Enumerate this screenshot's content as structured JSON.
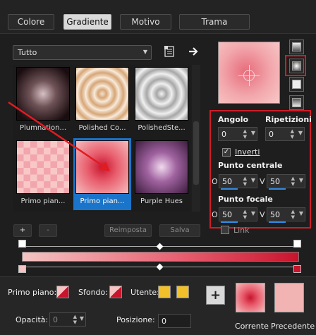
{
  "tabs": [
    {
      "label": "Colore",
      "active": false
    },
    {
      "label": "Gradiente",
      "active": true
    },
    {
      "label": "Motivo",
      "active": false
    },
    {
      "label": "Trama",
      "active": false
    }
  ],
  "library": {
    "filter_value": "Tutto",
    "thumbnails": [
      {
        "caption": "Plumnation...",
        "selected": false
      },
      {
        "caption": "Polished Co...",
        "selected": false
      },
      {
        "caption": "PolishedSte...",
        "selected": false
      },
      {
        "caption": "Primo pian...",
        "selected": false
      },
      {
        "caption": "Primo pian...",
        "selected": true
      },
      {
        "caption": "Purple Hues",
        "selected": false
      }
    ],
    "buttons": {
      "add": "+",
      "remove": "-",
      "reset": "Reimposta",
      "save": "Salva"
    }
  },
  "settings": {
    "angle_label": "Angolo",
    "angle_value": "0",
    "repeats_label": "Ripetizioni",
    "repeats_value": "0",
    "invert_label": "Inverti",
    "invert_checked": true,
    "center_label": "Punto centrale",
    "center_o_label": "O",
    "center_o_value": "50",
    "center_v_label": "V",
    "center_v_value": "50",
    "focal_label": "Punto focale",
    "focal_o_label": "O",
    "focal_o_value": "50",
    "focal_v_label": "V",
    "focal_v_value": "50",
    "link_label": "Link",
    "link_checked": false
  },
  "bottom": {
    "foreground_label": "Primo piano:",
    "background_label": "Sfondo:",
    "user_label": "Utente:",
    "opacity_label": "Opacità:",
    "opacity_value": "0",
    "position_label": "Posizione:",
    "position_value": "0",
    "current_label": "Corrente",
    "previous_label": "Precedente",
    "add_label": "+"
  },
  "colors": {
    "gradient_start": "#f5c4c3",
    "gradient_end": "#c8142d",
    "user_color": "#f2c02b",
    "highlight_red": "#d01c27",
    "selection_blue": "#1a74c9"
  }
}
